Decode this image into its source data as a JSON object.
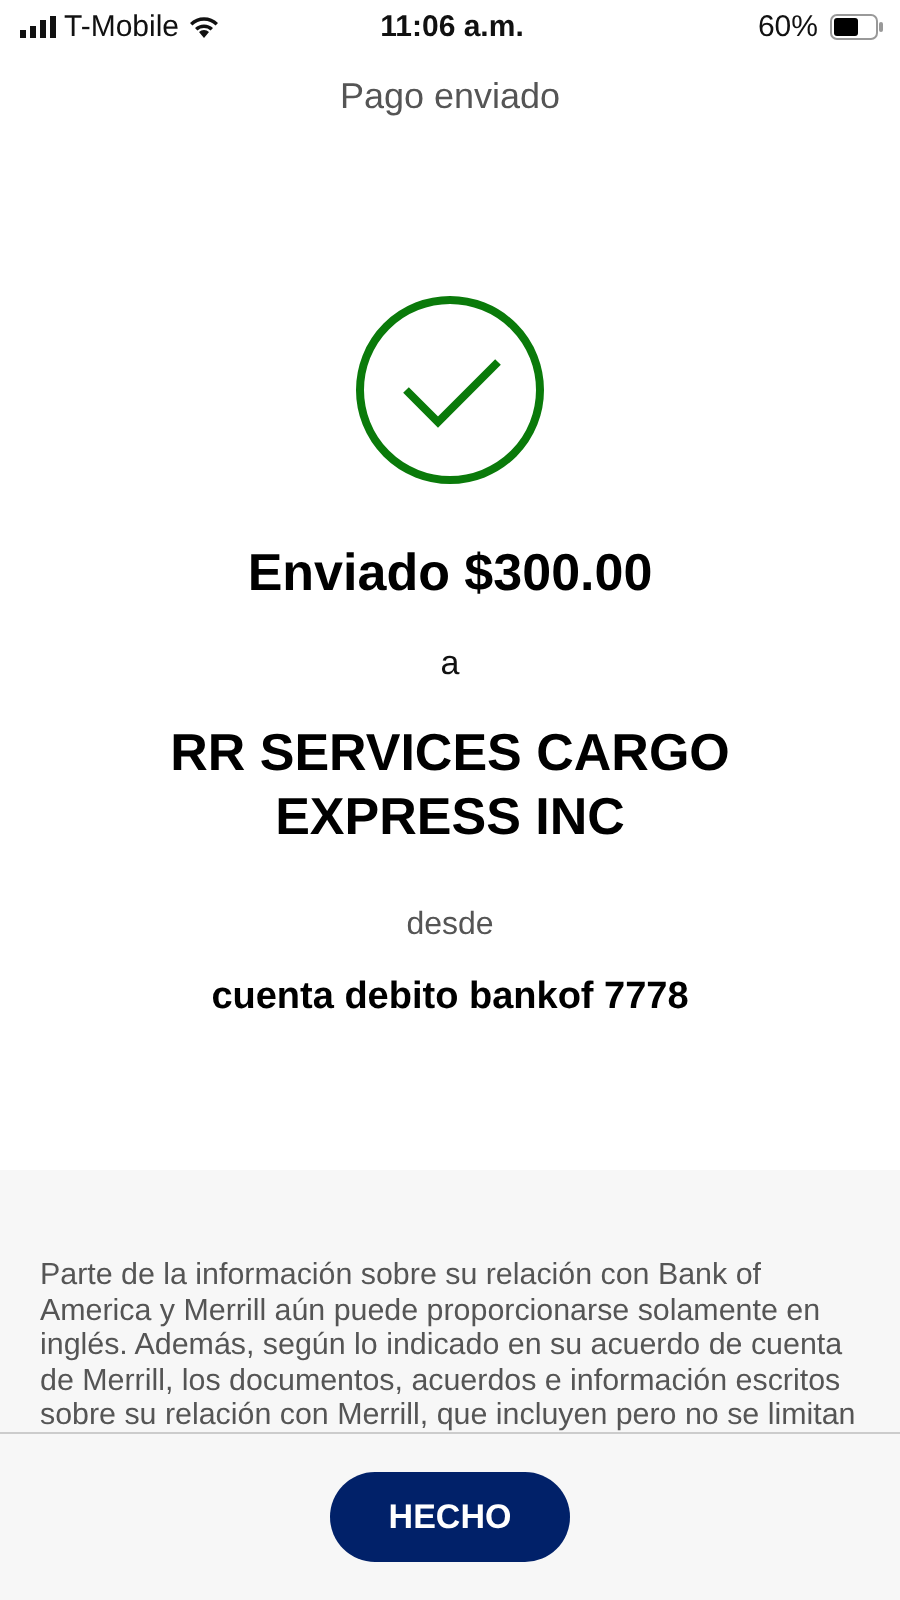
{
  "status_bar": {
    "carrier": "T-Mobile",
    "time": "11:06 a.m.",
    "battery": "60%"
  },
  "header": {
    "title": "Pago enviado"
  },
  "confirmation": {
    "amount_line": "Enviado $300.00",
    "to_label": "a",
    "recipient": "RR SERVICES CARGO EXPRESS INC",
    "from_label": "desde",
    "account": "cuenta debito bankof 7778"
  },
  "disclaimer": "Parte de la información sobre su relación con Bank of America y Merrill aún puede proporcionarse solamente en inglés. Además, según lo indicado en su acuerdo de cuenta de Merrill, los documentos, acuerdos e información escritos sobre su relación con Merrill, que incluyen pero no se limitan",
  "footer": {
    "button": "HECHO"
  }
}
